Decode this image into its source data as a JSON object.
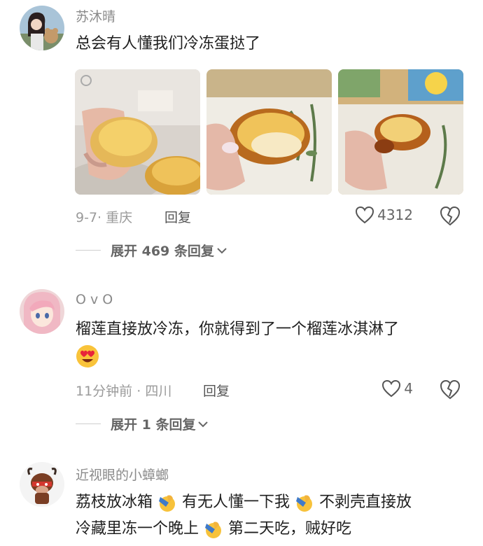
{
  "comments": [
    {
      "username": "苏沐晴",
      "text": "总会有人懂我们冷冻蛋挞了",
      "date": "9-7",
      "location": "重庆",
      "reply_label": "回复",
      "like_count": "4312",
      "expand_label": "展开 469 条回复",
      "photos": [
        "egg-tart-photo-1",
        "egg-tart-photo-2",
        "egg-tart-photo-3"
      ]
    },
    {
      "username": "O v O",
      "text": "榴莲直接放冷冻，你就得到了一个榴莲冰淇淋了",
      "emoji": "heart-eyes-emoji",
      "date": "11分钟前",
      "location": "四川",
      "reply_label": "回复",
      "like_count": "4",
      "expand_label": "展开 1 条回复"
    },
    {
      "username": "近视眼的小蟑螂",
      "text_parts": [
        "荔枝放冰箱",
        "有无人懂一下我",
        "不剥壳直接放",
        "冷藏里冻一个晚上",
        "第二天吃，贼好吃"
      ],
      "emoji": "facepalm-emoji"
    }
  ],
  "meta_separator": "·",
  "colors": {
    "text": "#1f1f1f",
    "muted": "#9a9a9a",
    "username": "#8a8a8a"
  }
}
